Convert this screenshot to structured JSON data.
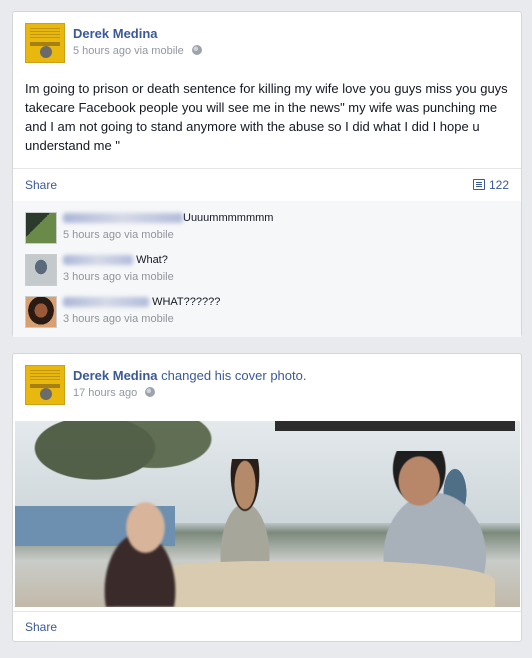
{
  "post1": {
    "author": "Derek Medina",
    "time": "5 hours ago",
    "via": "via mobile",
    "text": "Im going to prison or death sentence for killing my wife love you guys miss you guys takecare Facebook people you will see me in the news\" my wife was punching me and I am not going to stand anymore with the abuse so I did what I did I hope u understand me \"",
    "share_label": "Share",
    "comment_count": "122",
    "comments": [
      {
        "text": "Uuuummmmmmm",
        "time": "5 hours ago",
        "via": "via mobile"
      },
      {
        "text": "What?",
        "time": "3 hours ago",
        "via": "via mobile"
      },
      {
        "text": "WHAT??????",
        "time": "3 hours ago",
        "via": "via mobile"
      }
    ]
  },
  "post2": {
    "author": "Derek Medina",
    "action_pre": "changed his",
    "action_link": "cover photo",
    "action_post": ".",
    "time": "17 hours ago",
    "share_label": "Share"
  },
  "colors": {
    "link": "#3b5998",
    "meta": "#9197a3",
    "background": "#e9eaed"
  },
  "icons": [
    "globe-icon",
    "comment-count-icon"
  ]
}
